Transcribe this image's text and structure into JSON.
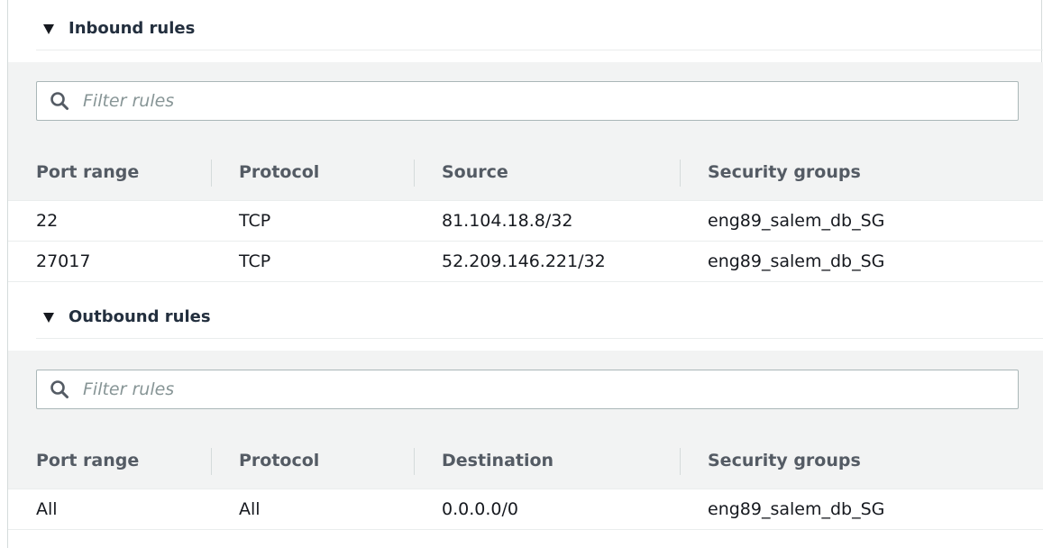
{
  "inbound": {
    "title": "Inbound rules",
    "filter_placeholder": "Filter rules",
    "columns": [
      "Port range",
      "Protocol",
      "Source",
      "Security groups"
    ],
    "rows": [
      [
        "22",
        "TCP",
        "81.104.18.8/32",
        "eng89_salem_db_SG"
      ],
      [
        "27017",
        "TCP",
        "52.209.146.221/32",
        "eng89_salem_db_SG"
      ]
    ]
  },
  "outbound": {
    "title": "Outbound rules",
    "filter_placeholder": "Filter rules",
    "columns": [
      "Port range",
      "Protocol",
      "Destination",
      "Security groups"
    ],
    "rows": [
      [
        "All",
        "All",
        "0.0.0.0/0",
        "eng89_salem_db_SG"
      ]
    ]
  },
  "icons": {
    "section_toggle": "caret-down-icon",
    "filter": "search-icon"
  },
  "colors": {
    "header_text": "#232f3e",
    "column_header_text": "#545b64",
    "placeholder_text": "#879596",
    "band_background": "#f2f3f3"
  }
}
